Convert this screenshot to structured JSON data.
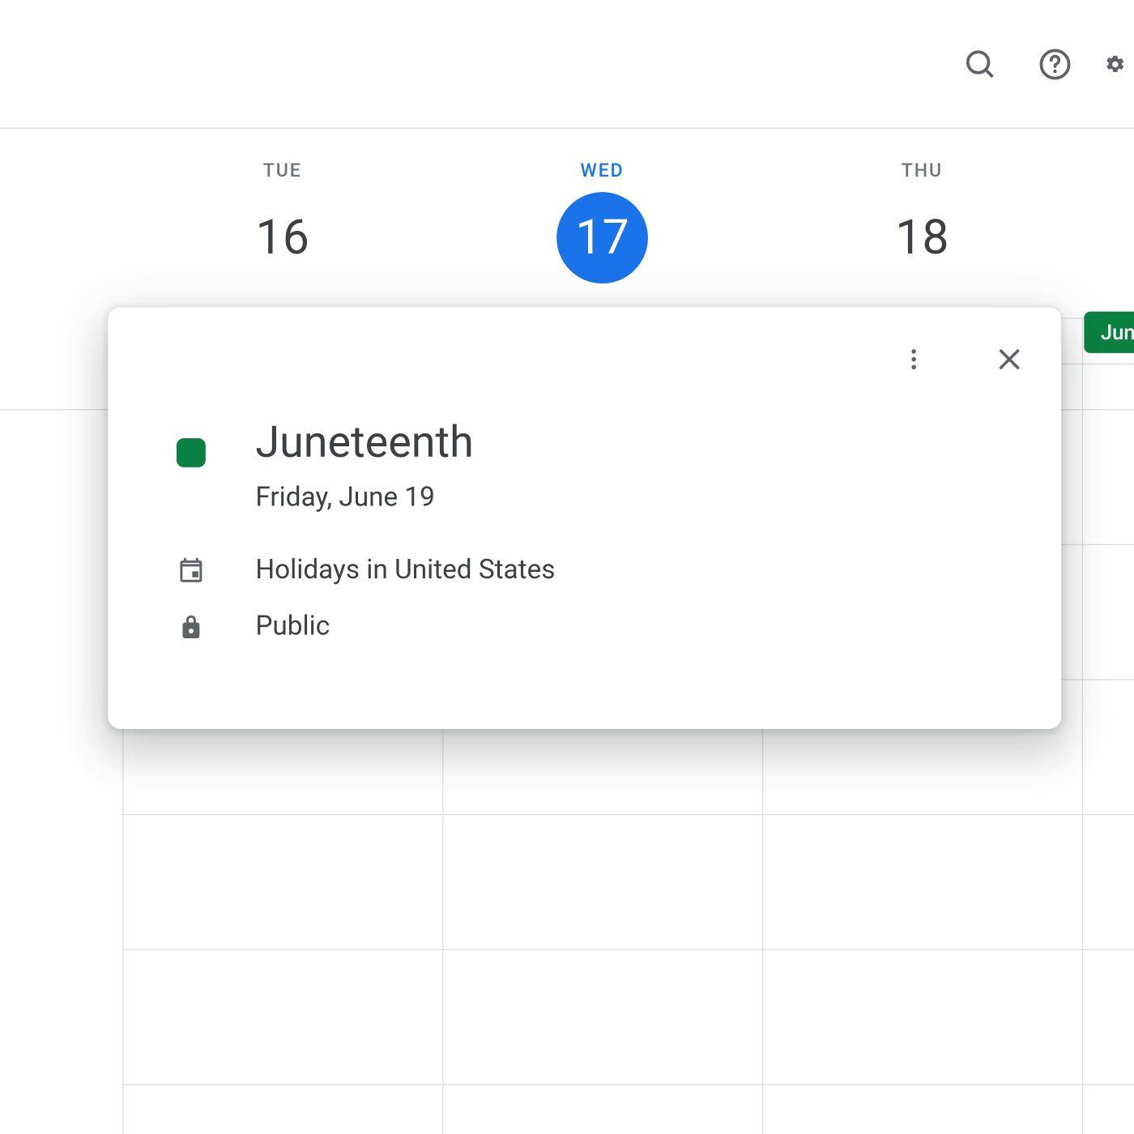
{
  "colors": {
    "accent": "#1a73e8",
    "event": "#0b8043"
  },
  "days": [
    {
      "dow": "TUE",
      "num": "16",
      "today": false
    },
    {
      "dow": "WED",
      "num": "17",
      "today": true
    },
    {
      "dow": "THU",
      "num": "18",
      "today": false
    }
  ],
  "chip": {
    "label": "Jun"
  },
  "popup": {
    "title": "Juneteenth",
    "date": "Friday, June 19",
    "calendar": "Holidays in United States",
    "visibility": "Public"
  }
}
